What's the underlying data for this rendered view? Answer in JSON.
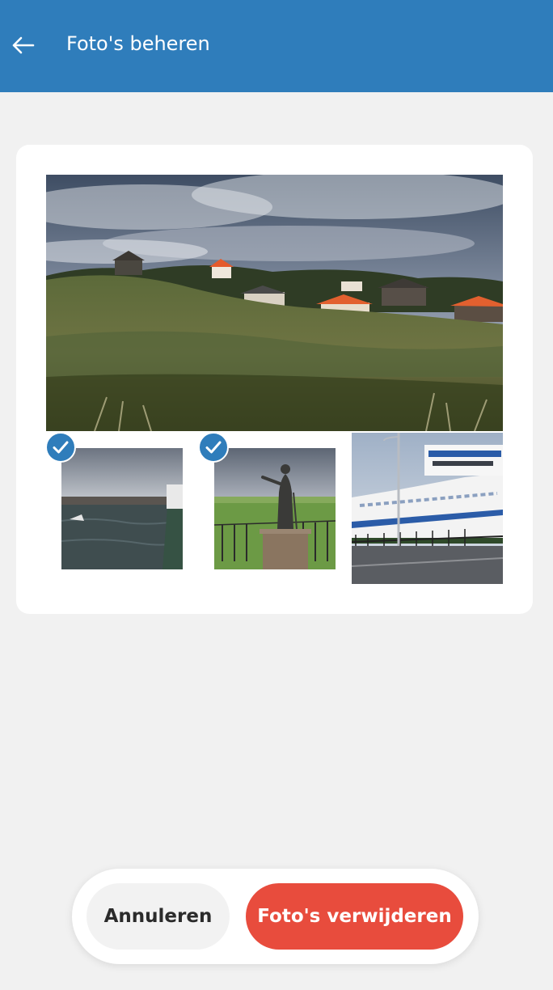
{
  "header": {
    "title": "Foto's beheren",
    "back_icon": "arrow-left-icon",
    "color": "#2f7dbb"
  },
  "photos": [
    {
      "name": "dunes-village",
      "selected": false
    },
    {
      "name": "harbor-water",
      "selected": true
    },
    {
      "name": "statue-field",
      "selected": true
    },
    {
      "name": "ferry-ship",
      "selected": false
    }
  ],
  "check_icon": "checkmark-icon",
  "actions": {
    "cancel_label": "Annuleren",
    "delete_label": "Foto's verwijderen",
    "delete_color": "#e84c3d"
  }
}
